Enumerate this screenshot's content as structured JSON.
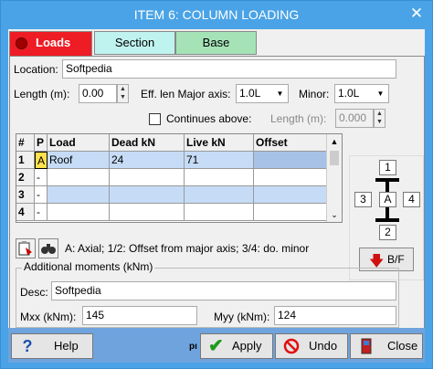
{
  "window": {
    "title": "ITEM 6: COLUMN LOADING"
  },
  "tabs": [
    {
      "label": "Loads",
      "active": true
    },
    {
      "label": "Section",
      "active": false
    },
    {
      "label": "Base",
      "active": false
    }
  ],
  "form": {
    "location_label": "Location:",
    "location_value": "Softpedia",
    "length_label": "Length (m):",
    "length_value": "0.00",
    "eff_len_label": "Eff. len Major axis:",
    "major_value": "1.0L",
    "minor_label": "Minor:",
    "minor_value": "1.0L",
    "continues_label": "Continues above:",
    "length_above_label": "Length (m):",
    "length_above_value": "0.000"
  },
  "grid": {
    "headers": [
      "#",
      "P",
      "Load",
      "Dead kN",
      "Live kN",
      "Offset"
    ],
    "rows": [
      {
        "num": "1",
        "p": "A",
        "load": "Roof",
        "dead": "24",
        "live": "71",
        "offset": ""
      },
      {
        "num": "2",
        "p": "-",
        "load": "",
        "dead": "",
        "live": "",
        "offset": ""
      },
      {
        "num": "3",
        "p": "-",
        "load": "",
        "dead": "",
        "live": "",
        "offset": ""
      },
      {
        "num": "4",
        "p": "-",
        "load": "",
        "dead": "",
        "live": "",
        "offset": ""
      }
    ]
  },
  "diagram": {
    "top": "1",
    "left": "3",
    "center": "A",
    "right": "4",
    "bottom": "2",
    "bf_label": "B/F"
  },
  "hint_text": "A: Axial; 1/2: Offset from major axis; 3/4: do. minor",
  "moments": {
    "group_label": "Additional moments (kNm)",
    "desc_label": "Desc:",
    "desc_value": "Softpedia",
    "mxx_label": "Mxx (kNm):",
    "mxx_value": "145",
    "myy_label": "Myy (kNm):",
    "myy_value": "124"
  },
  "footer": {
    "help": "Help",
    "partial_text": "pı",
    "apply": "Apply",
    "undo": "Undo",
    "close": "Close"
  },
  "colors": {
    "title_bar": "#4aa3e6",
    "active_tab": "#ee1c24",
    "section_tab": "#bff3ef",
    "base_tab": "#a5e3b7",
    "selected_row": "#c6dcf6",
    "footer_bar": "#6fa3dd"
  }
}
